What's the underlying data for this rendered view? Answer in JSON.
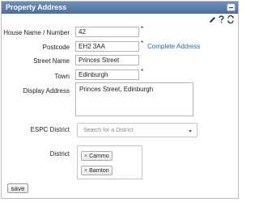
{
  "header": {
    "title": "Property Address"
  },
  "form": {
    "house_label": "House Name / Number",
    "house_value": "42",
    "postcode_label": "Postcode",
    "postcode_value": "EH2 3AA",
    "complete_address_link": "Complete Address",
    "street_label": "Street Name",
    "street_value": "Princes Street",
    "town_label": "Town",
    "town_value": "Edinburgh",
    "display_label": "Display Address",
    "display_value": "Princes Street, Edinburgh",
    "espc_label": "ESPC District",
    "espc_placeholder": "Search for a District",
    "district_label": "District",
    "district_tags": [
      "Cammo",
      "Barnton"
    ],
    "required_marker": "*",
    "remove_marker": "×"
  },
  "footer": {
    "save_label": "save"
  }
}
